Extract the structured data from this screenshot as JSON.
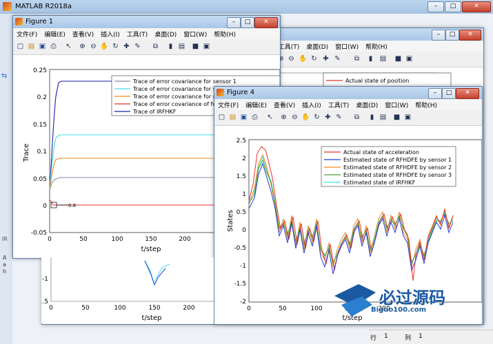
{
  "main": {
    "title": "MATLAB R2018a"
  },
  "menus": [
    "文件(F)",
    "编辑(E)",
    "查看(V)",
    "插入(I)",
    "工具(T)",
    "桌面(D)",
    "窗口(W)",
    "帮助(H)"
  ],
  "fig1": {
    "title": "Figure 1",
    "legend": [
      "Trace of error covariance for sensor 1",
      "Trace of error covariance for se",
      "Trace of error covariance for se",
      "Trace of error covariance of fus",
      "Trace of IRFHKF"
    ],
    "xlabel": "t/step",
    "ylabel": "Trace",
    "yticks": [
      "0.25",
      "0.2",
      "0.15",
      "0.1",
      "0.05",
      "0",
      "-0.05"
    ],
    "xticks": [
      "0",
      "50",
      "100",
      "150",
      "200"
    ],
    "annot": "0.8"
  },
  "fig4": {
    "title": "Figure 4",
    "legend": [
      "Actual state of acceleration",
      "Estimated state of RFHDFE by sensor 1",
      "Estimated state of RFHDFE by sensor 2",
      "Estimated state of RFHDFE by sensor 3",
      "Estimated state of IRFHKF"
    ],
    "xlabel": "t/step",
    "ylabel": "States",
    "yticks": [
      "2.5",
      "2",
      "1.5",
      "1",
      "0.5",
      "0",
      "-0.5",
      "-1",
      "-1.5",
      "-2"
    ],
    "xticks": [
      "0",
      "50",
      "100",
      "150",
      "200"
    ]
  },
  "back_fig": {
    "legend": [
      "Actual state of position"
    ],
    "yticks": [
      "-1",
      "-1.5"
    ],
    "xticks": [
      "0",
      "50",
      "100",
      "150",
      "200"
    ],
    "xlabel": "t/step"
  },
  "statusbar": {
    "row_label": "行",
    "row_value": "1",
    "col_label": "列",
    "col_value": "1"
  },
  "watermark": {
    "brand": "必过源码",
    "url": "Biguo100.com"
  },
  "colors": {
    "red": "#e8332a",
    "blue": "#1f3fd6",
    "orange": "#f08a1c",
    "cyan": "#3fe0e8",
    "gray": "#8a8aa6",
    "navy": "#1a1aa8"
  }
}
